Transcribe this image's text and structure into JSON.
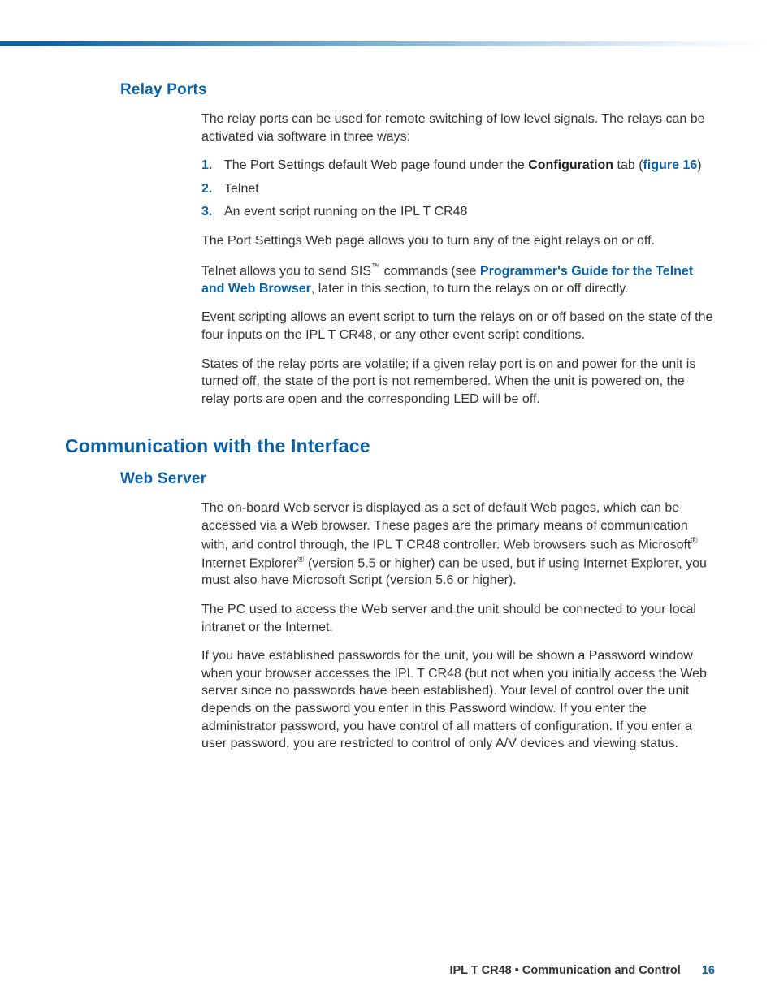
{
  "sections": {
    "relay": {
      "heading": "Relay Ports",
      "intro": "The relay ports can be used for remote switching of low level signals. The relays can be activated via software in three ways:",
      "list": {
        "i1_num": "1.",
        "i1_a": "The Port Settings default Web page found under the ",
        "i1_bold": "Configuration",
        "i1_b": " tab (",
        "i1_link": "figure 16",
        "i1_c": ")",
        "i2_num": "2.",
        "i2": "Telnet",
        "i3_num": "3.",
        "i3": "An event script running on the IPL T CR48"
      },
      "p2": "The Port Settings Web page allows you to turn any of the eight relays on or off.",
      "p3_a": "Telnet allows you to send SIS",
      "p3_tm": "™",
      "p3_b": " commands (see ",
      "p3_link": "Programmer's Guide for the Telnet and Web Browser",
      "p3_c": ", later in this section, to turn the relays on or off directly.",
      "p4": "Event scripting allows an event script to turn the relays on or off based on the state of the four inputs on the IPL T CR48, or any other event script conditions.",
      "p5": "States of the relay ports are volatile; if a given relay port is on and power for the unit is turned off, the state of the port is not remembered. When the unit is powered on, the relay ports are open and the corresponding LED will be off."
    },
    "comm": {
      "heading": "Communication with the Interface",
      "web": {
        "heading": "Web Server",
        "p1_a": "The on-board Web server is displayed as a set of default Web pages, which can be accessed via a Web browser. These pages are the primary means of communication with, and control through, the IPL T CR48 controller. Web browsers such as Microsoft",
        "p1_r1": "®",
        "p1_b": " Internet Explorer",
        "p1_r2": "®",
        "p1_c": " (version 5.5 or higher) can be used, but if using Internet Explorer, you must also have Microsoft Script (version 5.6 or higher).",
        "p2": "The PC used to access the Web server and the unit should be connected to your local intranet or the Internet.",
        "p3": "If you have established passwords for the unit, you will be shown a Password window when your browser accesses the IPL T CR48 (but not when you initially access the Web server since no passwords have been established). Your level of control over the unit depends on the password you enter in this Password window. If you enter the administrator password, you have control of all matters of configuration. If you enter a user password, you are restricted to control of only A/V devices and viewing status."
      }
    }
  },
  "footer": {
    "title": "IPL T CR48 • Communication and Control",
    "page": "16"
  }
}
